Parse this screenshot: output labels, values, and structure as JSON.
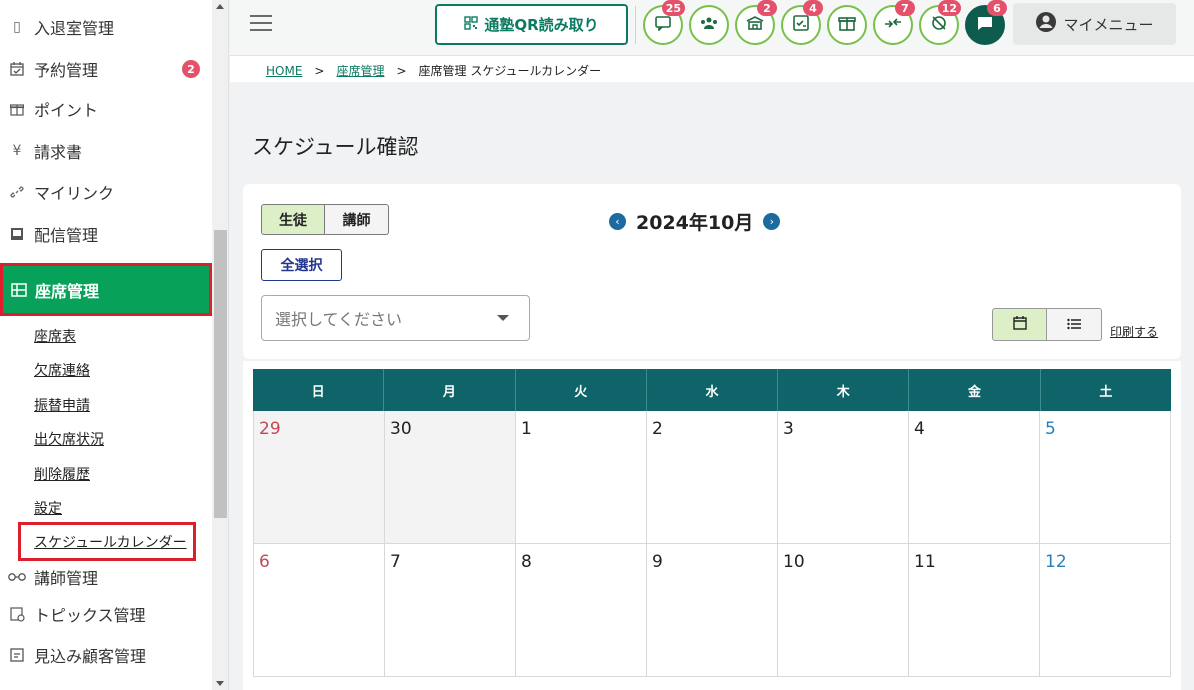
{
  "sidebar": {
    "items": [
      {
        "label": "入退室管理",
        "icon": "phone-icon"
      },
      {
        "label": "予約管理",
        "icon": "calendar-check-icon",
        "badge": "2"
      },
      {
        "label": "ポイント",
        "icon": "gift-icon"
      },
      {
        "label": "請求書",
        "icon": "yen-icon"
      },
      {
        "label": "マイリンク",
        "icon": "link-icon"
      },
      {
        "label": "配信管理",
        "icon": "broadcast-icon"
      }
    ],
    "active": {
      "label": "座席管理",
      "icon": "seat-grid-icon"
    },
    "subitems": [
      "座席表",
      "欠席連絡",
      "振替申請",
      "出欠席状況",
      "削除履歴",
      "設定"
    ],
    "active_sub": "スケジュールカレンダー",
    "after": [
      {
        "label": "講師管理",
        "icon": "glasses-icon"
      },
      {
        "label": "トピックス管理",
        "icon": "topics-icon"
      },
      {
        "label": "見込み顧客管理",
        "icon": "prospect-icon"
      }
    ]
  },
  "header": {
    "qr_label": "通塾QR読み取り",
    "icons": [
      {
        "name": "chat-icon",
        "badge": "25"
      },
      {
        "name": "group-icon",
        "badge": ""
      },
      {
        "name": "school-icon",
        "badge": "2"
      },
      {
        "name": "checklist-icon",
        "badge": "4"
      },
      {
        "name": "gift-icon",
        "badge": ""
      },
      {
        "name": "swap-icon",
        "badge": "7"
      },
      {
        "name": "no-location-icon",
        "badge": "12"
      },
      {
        "name": "message-icon",
        "badge": "6"
      }
    ],
    "mymenu_label": "マイメニュー"
  },
  "breadcrumb": {
    "home": "HOME",
    "parent": "座席管理",
    "current": "座席管理 スケジュールカレンダー"
  },
  "page": {
    "title": "スケジュール確認"
  },
  "controls": {
    "toggle_student": "生徒",
    "toggle_teacher": "講師",
    "month": "2024年10月",
    "select_all": "全選択",
    "select_placeholder": "選択してください",
    "print": "印刷する"
  },
  "calendar": {
    "weekdays": [
      "日",
      "月",
      "火",
      "水",
      "木",
      "金",
      "土"
    ],
    "weeks": [
      [
        "29",
        "30",
        "1",
        "2",
        "3",
        "4",
        "5"
      ],
      [
        "6",
        "7",
        "8",
        "9",
        "10",
        "11",
        "12"
      ]
    ]
  }
}
